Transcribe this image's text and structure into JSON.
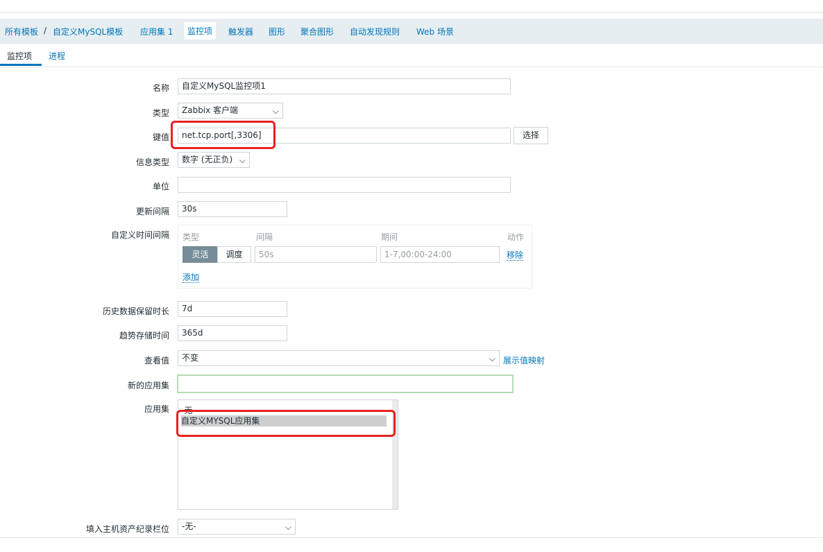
{
  "breadcrumb": {
    "all_templates": "所有模板",
    "separator": "/",
    "template": "自定义MySQL模板",
    "applications": "应用集 1",
    "items": "监控项",
    "triggers": "触发器",
    "graphs": "图形",
    "screens": "聚合图形",
    "discovery": "自动发现规则",
    "web": "Web 场景"
  },
  "tabs": {
    "item": "监控项",
    "preprocessing": "进程"
  },
  "form": {
    "name_label": "名称",
    "name_value": "自定义MySQL监控项1",
    "type_label": "类型",
    "type_value": "Zabbix 客户端",
    "key_label": "键值",
    "key_value": "net.tcp.port[,3306]",
    "key_select": "选择",
    "info_type_label": "信息类型",
    "info_type_value": "数字 (无正负)",
    "units_label": "单位",
    "units_value": "",
    "interval_label": "更新间隔",
    "interval_value": "30s",
    "custom_label": "自定义时间间隔",
    "custom": {
      "col_type": "类型",
      "col_interval": "间隔",
      "col_period": "期间",
      "col_action": "动作",
      "flexible": "灵活",
      "scheduling": "调度",
      "interval_placeholder": "50s",
      "period_placeholder": "1-7,00:00-24:00",
      "remove": "移除",
      "add": "添加"
    },
    "history_label": "历史数据保留时长",
    "history_value": "7d",
    "trends_label": "趋势存储时间",
    "trends_value": "365d",
    "valuemap_label": "查看值",
    "valuemap_value": "不变",
    "valuemap_link": "展示值映射",
    "new_app_label": "新的应用集",
    "new_app_value": "",
    "apps_label": "应用集",
    "apps_options": [
      "-无-",
      "自定义MYSQL应用集"
    ],
    "inventory_label": "填入主机资产纪录栏位",
    "inventory_value": "-无-"
  },
  "colors": {
    "accent": "#0275b8",
    "highlight": "#e8201f",
    "focus_green": "#b5dbb5"
  }
}
